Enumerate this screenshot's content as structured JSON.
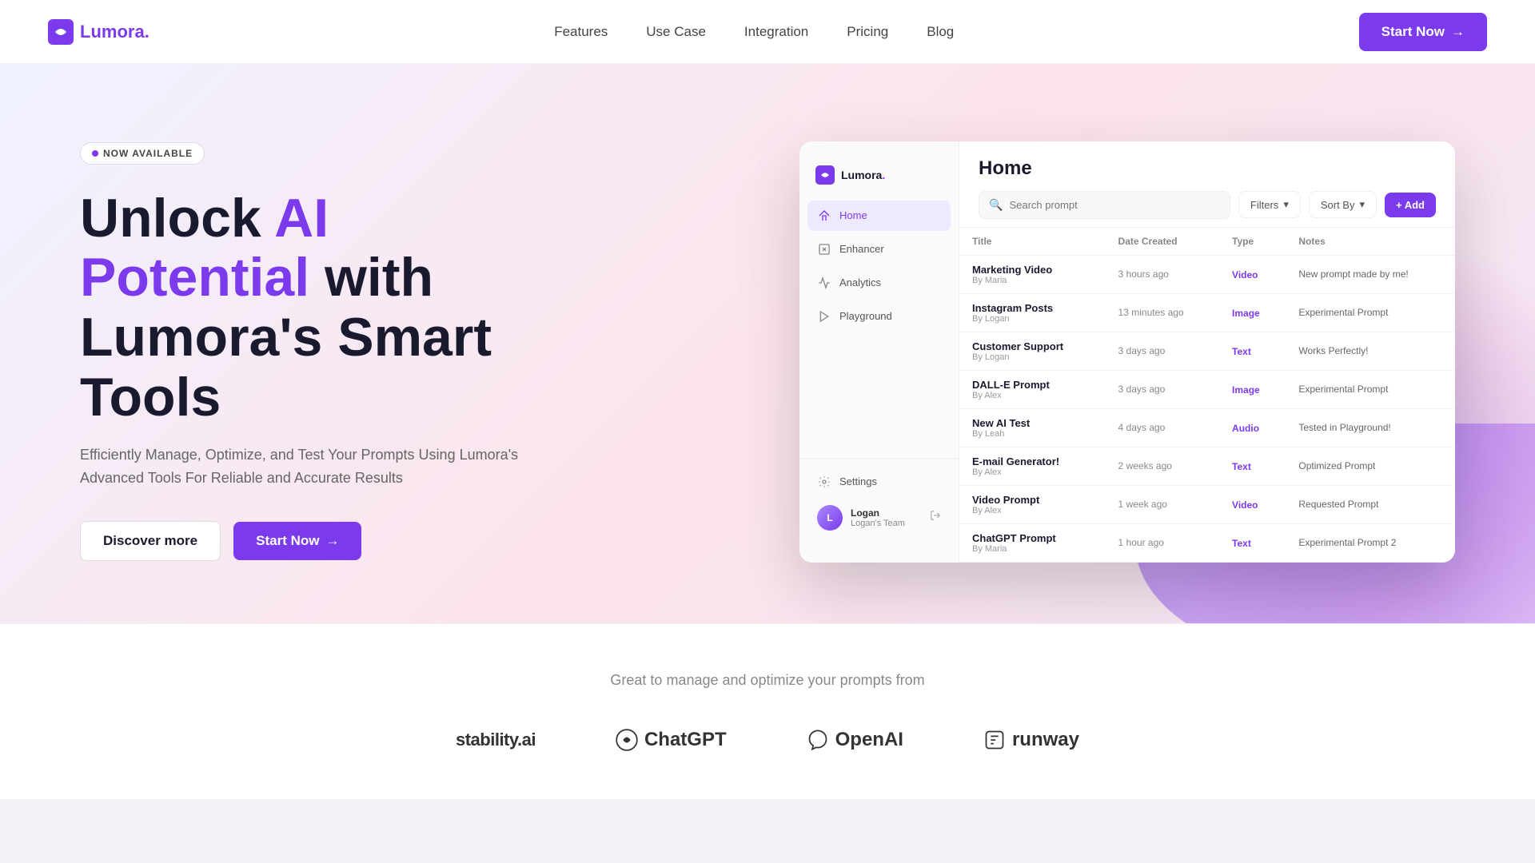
{
  "nav": {
    "logo_text": "Lumora",
    "logo_dot": ".",
    "links": [
      {
        "label": "Features",
        "id": "features"
      },
      {
        "label": "Use Case",
        "id": "use-case"
      },
      {
        "label": "Integration",
        "id": "integration"
      },
      {
        "label": "Pricing",
        "id": "pricing"
      },
      {
        "label": "Blog",
        "id": "blog"
      }
    ],
    "cta_label": "Start Now"
  },
  "hero": {
    "badge": "NOW AVAILABLE",
    "title_line1": "Unlock ",
    "title_highlight1": "AI",
    "title_line2": "Potential",
    "title_line2_rest": " with",
    "title_line3": "Lumora's Smart",
    "title_line4": "Tools",
    "subtitle": "Efficiently Manage, Optimize, and Test Your Prompts Using Lumora's Advanced Tools For Reliable and Accurate Results",
    "btn_discover": "Discover more",
    "btn_start": "Start Now"
  },
  "sidebar": {
    "logo_text": "Lumora",
    "logo_dot": ".",
    "items": [
      {
        "label": "Home",
        "id": "home",
        "active": true
      },
      {
        "label": "Enhancer",
        "id": "enhancer",
        "active": false
      },
      {
        "label": "Analytics",
        "id": "analytics",
        "active": false
      },
      {
        "label": "Playground",
        "id": "playground",
        "active": false
      }
    ],
    "settings_label": "Settings",
    "user": {
      "name": "Logan",
      "team": "Logan's Team"
    }
  },
  "app": {
    "page_title": "Home",
    "search_placeholder": "Search prompt",
    "filters_label": "Filters",
    "sort_label": "Sort By",
    "add_label": "+ Add",
    "table": {
      "columns": [
        "Title",
        "Date Created",
        "Type",
        "Notes"
      ],
      "rows": [
        {
          "title": "Marketing Video",
          "author": "By Maria",
          "date": "3 hours ago",
          "type": "Video",
          "notes": "New prompt made by me!"
        },
        {
          "title": "Instagram Posts",
          "author": "By Logan",
          "date": "13 minutes ago",
          "type": "Image",
          "notes": "Experimental Prompt"
        },
        {
          "title": "Customer Support",
          "author": "By Logan",
          "date": "3 days ago",
          "type": "Text",
          "notes": "Works Perfectly!"
        },
        {
          "title": "DALL-E Prompt",
          "author": "By Alex",
          "date": "3 days ago",
          "type": "Image",
          "notes": "Experimental Prompt"
        },
        {
          "title": "New AI Test",
          "author": "By Leah",
          "date": "4 days ago",
          "type": "Audio",
          "notes": "Tested in Playground!"
        },
        {
          "title": "E-mail Generator!",
          "author": "By Alex",
          "date": "2 weeks ago",
          "type": "Text",
          "notes": "Optimized Prompt"
        },
        {
          "title": "Video Prompt",
          "author": "By Alex",
          "date": "1 week ago",
          "type": "Video",
          "notes": "Requested Prompt"
        },
        {
          "title": "ChatGPT Prompt",
          "author": "By Maria",
          "date": "1 hour ago",
          "type": "Text",
          "notes": "Experimental Prompt 2"
        }
      ]
    }
  },
  "bottom": {
    "tagline": "Great to manage and optimize your prompts from",
    "logos": [
      {
        "label": "stability.ai",
        "id": "stability"
      },
      {
        "label": "ChatGPT",
        "id": "chatgpt"
      },
      {
        "label": "OpenAI",
        "id": "openai"
      },
      {
        "label": "runway",
        "id": "runway"
      }
    ]
  }
}
